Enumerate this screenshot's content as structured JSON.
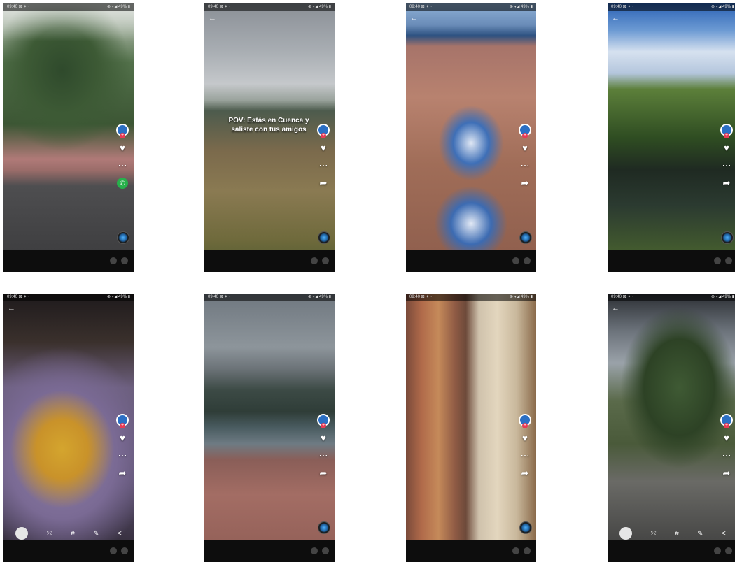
{
  "phones": [
    {
      "id": "p1",
      "status": {
        "time": "09:40 ⊠ ✦ ·",
        "battery": "⊕ ▾◢ 49% ▮"
      },
      "overlay_text": "",
      "caption": {
        "user": "",
        "text": ""
      },
      "music": "",
      "comment_placeholder": ""
    },
    {
      "id": "p2",
      "status": {
        "time": "09:40 ⊠ ✦ ·",
        "battery": "⊕ ▾◢ 49% ▮"
      },
      "overlay_text": "POV: Estás en Cuenca y saliste con tus amigos",
      "caption": {
        "user": "",
        "text": ""
      },
      "music": "",
      "comment_placeholder": ""
    },
    {
      "id": "p3",
      "status": {
        "time": "09:40 ⊠ ✦ ·",
        "battery": "⊕ ▾◢ 49% ▮"
      },
      "overlay_text": "",
      "caption": {
        "user": "",
        "text": ""
      },
      "music": "",
      "comment_placeholder": ""
    },
    {
      "id": "p4",
      "status": {
        "time": "09:40 ⊠ ✦ ·",
        "battery": "⊕ ▾◢ 49% ▮"
      },
      "overlay_text": "",
      "caption": {
        "user": "",
        "text": ""
      },
      "music": "",
      "comment_placeholder": ""
    },
    {
      "id": "p5",
      "status": {
        "time": "09:40 ⊠ ✦ ·",
        "battery": "⊕ ▾◢ 49% ▮"
      },
      "overlay_text": "",
      "caption": {
        "user": "",
        "text": ""
      },
      "music": "",
      "comment_placeholder": ""
    },
    {
      "id": "p6",
      "status": {
        "time": "09:40 ⊠ ✦ ·",
        "battery": "⊕ ▾◢ 49% ▮"
      },
      "overlay_text": "",
      "caption": {
        "user": "",
        "text": ""
      },
      "music": "",
      "comment_placeholder": ""
    },
    {
      "id": "p7",
      "status": {
        "time": "09:40 ⊠ ✦ ·",
        "battery": "⊕ ▾◢ 49% ▮"
      },
      "overlay_text": "",
      "caption": {
        "user": "",
        "text": ""
      },
      "music": "",
      "comment_placeholder": ""
    },
    {
      "id": "p8",
      "status": {
        "time": "09:40 ⊠ ✦ ·",
        "battery": "⊕ ▾◢ 49% ▮"
      },
      "overlay_text": "",
      "caption": {
        "user": "",
        "text": ""
      },
      "music": "",
      "comment_placeholder": ""
    }
  ],
  "icons": {
    "back": "←",
    "like": "♥",
    "comment": "⋯",
    "share": "➦",
    "music": "♫",
    "whatsapp": "✆",
    "plus": "+"
  },
  "colors": {
    "accent_like": "#e83b55",
    "avatar": "#2b6fc4",
    "whatsapp": "#27b04b",
    "comment_bar": "#0d0d0d"
  }
}
